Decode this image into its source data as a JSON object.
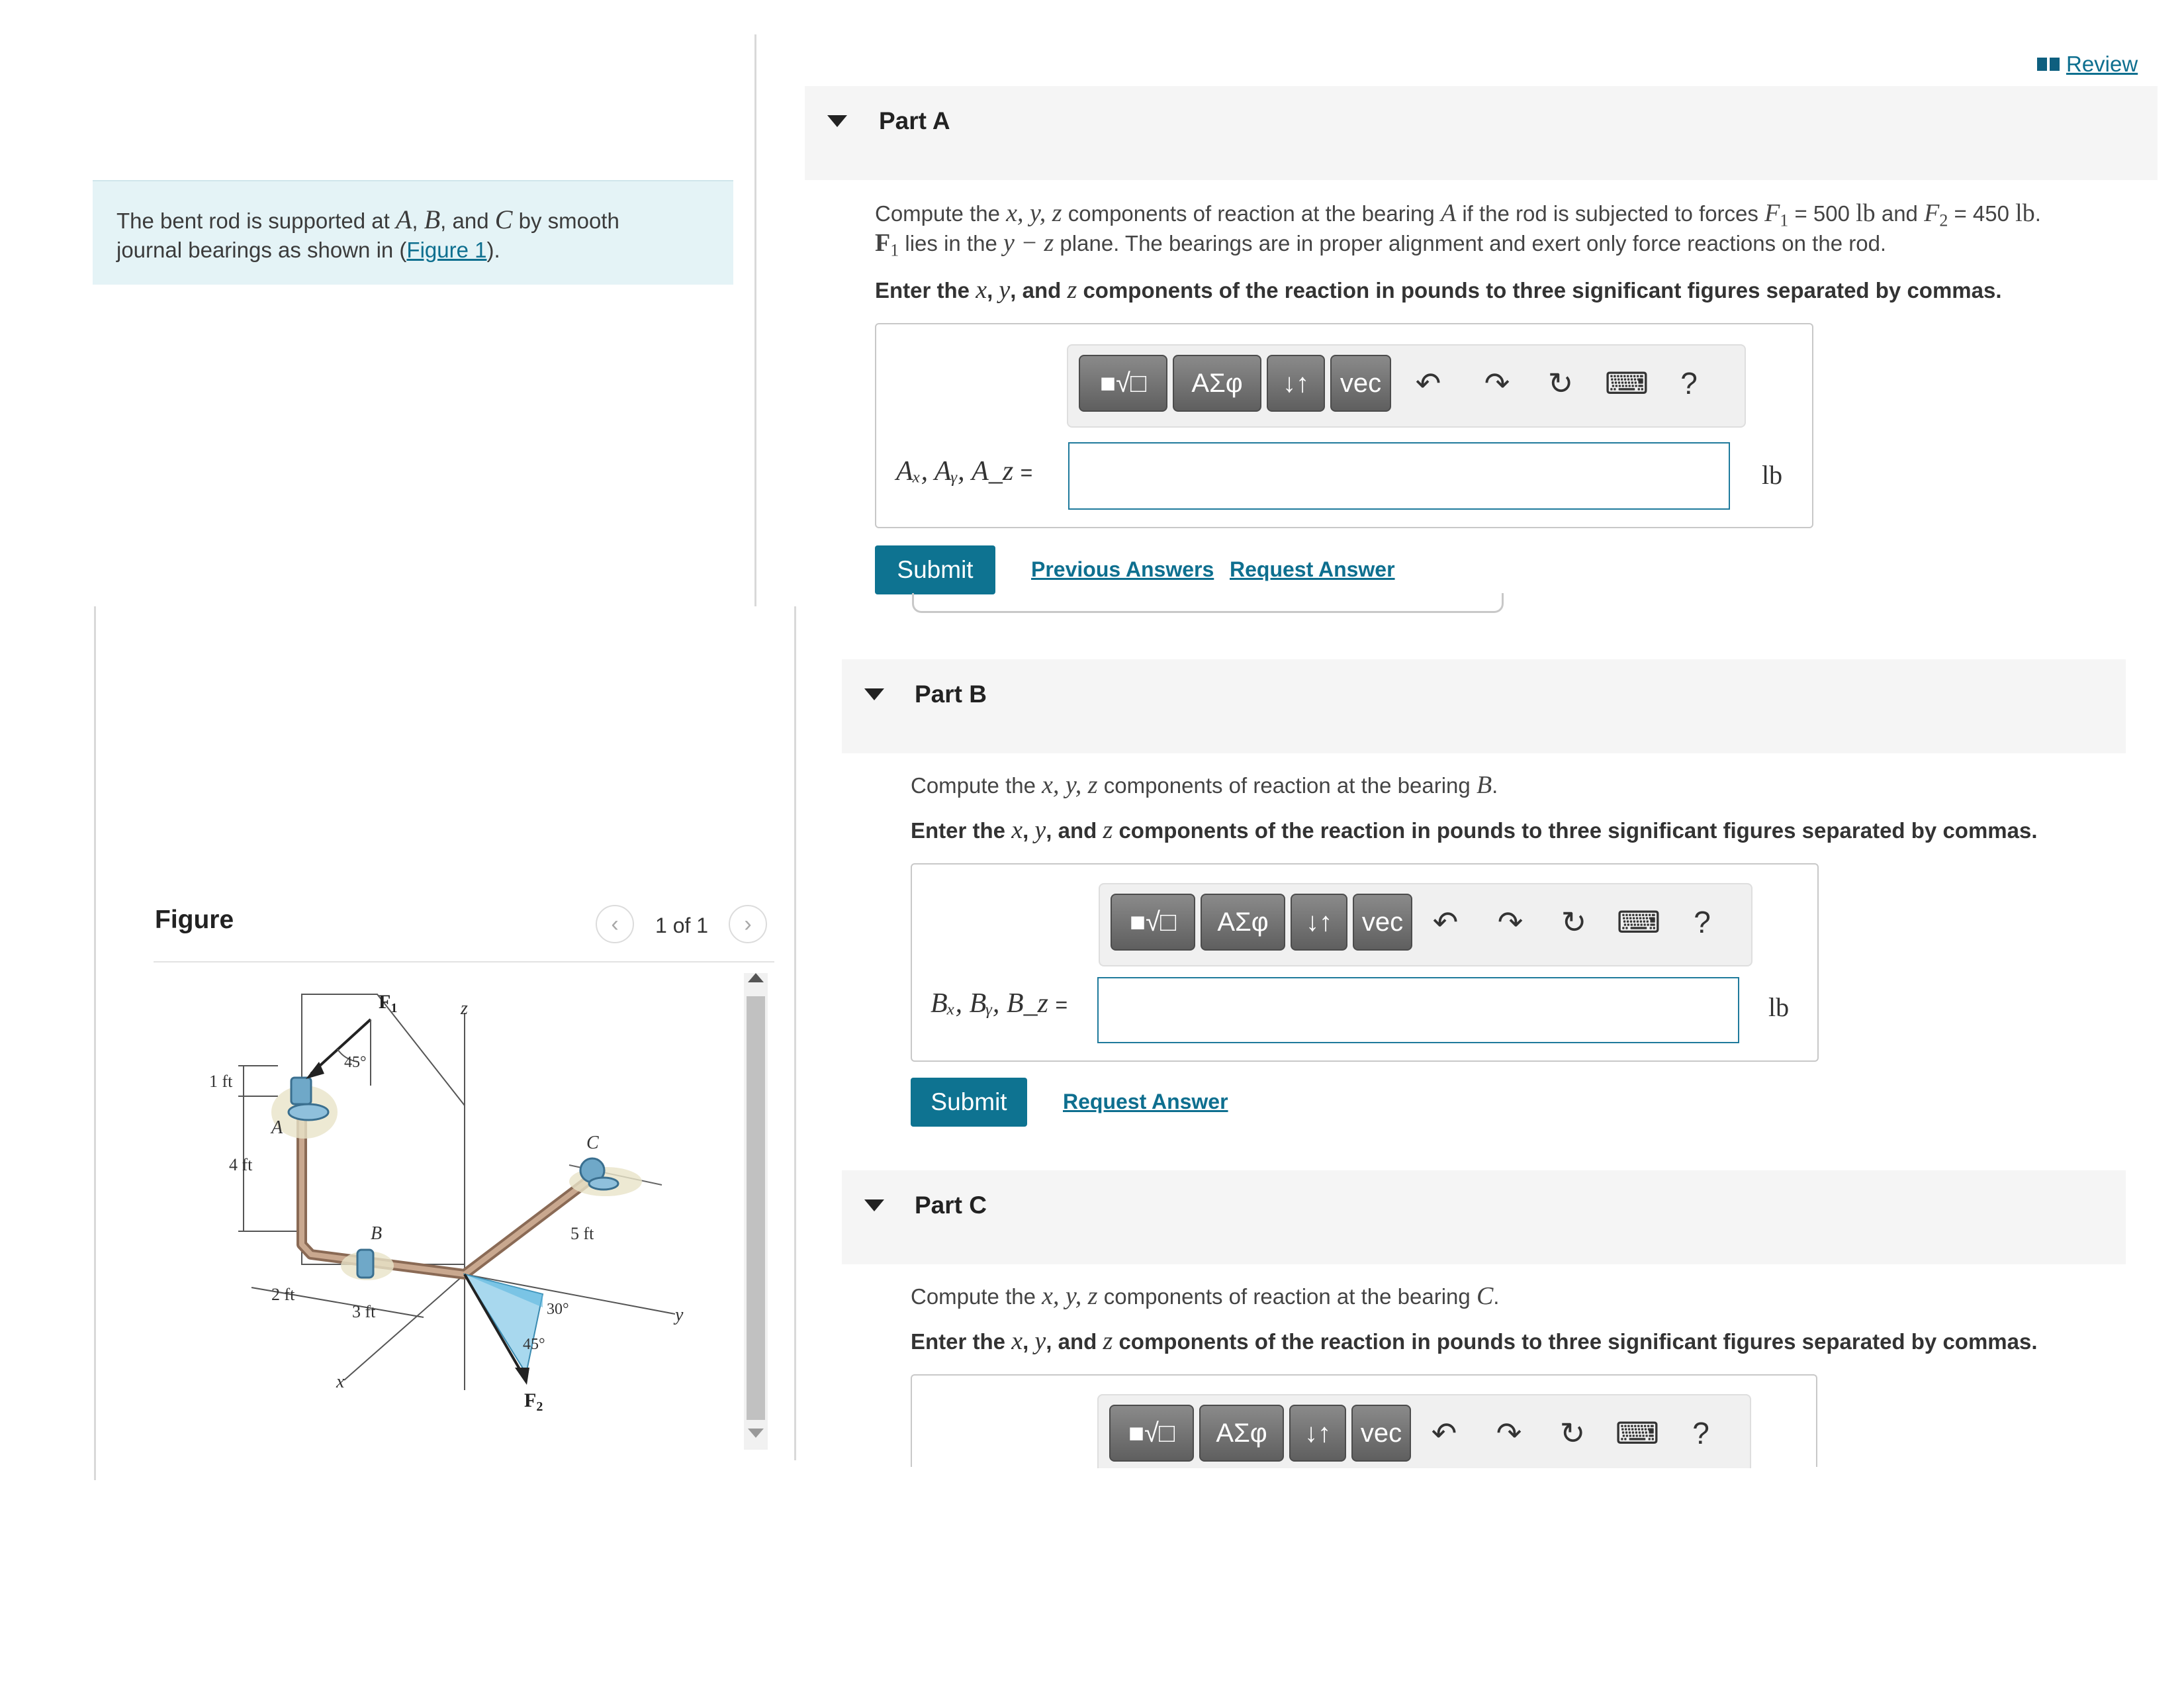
{
  "intro": {
    "text_1": "The bent rod is supported at ",
    "var_a": "A",
    "sep_1": ", ",
    "var_b": "B",
    "sep_2": ", and ",
    "var_c": "C",
    "text_2": " by smooth",
    "text_3": "journal bearings as shown in (",
    "figure_link": "Figure 1",
    "text_4": ")."
  },
  "figure": {
    "title": "Figure",
    "prev": "‹",
    "next": "›",
    "count": "1 of 1",
    "labels": {
      "F1": "F",
      "F1_sub": "1",
      "F2": "F",
      "F2_sub": "2",
      "z": "z",
      "y": "y",
      "x": "x",
      "A": "A",
      "B": "B",
      "C": "C",
      "one_ft": "1 ft",
      "four_ft": "4 ft",
      "two_ft": "2 ft",
      "three_ft": "3 ft",
      "five_ft": "5 ft",
      "deg45_top": "45°",
      "deg30": "30°",
      "deg45_bottom": "45°"
    }
  },
  "review": {
    "label": "Review"
  },
  "toolbar": {
    "templates": "■√□",
    "symbols": "ΑΣφ",
    "arrows": "↓↑",
    "vec": "vec",
    "undo": "↶",
    "redo": "↷",
    "reset": "↻",
    "keyboard": "⌨",
    "help": "?"
  },
  "partA": {
    "title": "Part A",
    "q1_a": "Compute the ",
    "q1_vars": "x, y, z",
    "q1_b": " components of reaction at the bearing ",
    "q1_var": "A",
    "q1_c": " if the rod is subjected to forces ",
    "q1_f1": "F",
    "q1_f1_sub": "1",
    "q1_d": " = 500 ",
    "q1_unit1": "lb",
    "q1_e": " and ",
    "q1_f2": "F",
    "q1_f2_sub": "2",
    "q1_f": " = 450 ",
    "q1_unit2": "lb",
    "q1_g": ".",
    "q2_f1": "F",
    "q2_f1_sub": "1",
    "q2_a": " lies in the ",
    "q2_plane": "y − z",
    "q2_b": " plane. The bearings are in proper alignment and exert only force reactions on the rod.",
    "instr_a": "Enter the ",
    "instr_x": "x",
    "instr_b": ", ",
    "instr_y": "y",
    "instr_c": ", and ",
    "instr_z": "z",
    "instr_d": " components of the reaction in pounds to three significant figures separated by commas.",
    "answer_label": "Aₓ,  Aᵧ,  A_z",
    "answer_value": "",
    "unit": "lb",
    "submit": "Submit",
    "previous_answers": "Previous Answers",
    "request_answer": "Request Answer"
  },
  "partB": {
    "title": "Part B",
    "q1_a": "Compute the ",
    "q1_vars": "x, y, z",
    "q1_b": " components of reaction at the bearing ",
    "q1_var": "B",
    "q1_c": ".",
    "instr_a": "Enter the ",
    "instr_x": "x",
    "instr_b": ", ",
    "instr_y": "y",
    "instr_c": ", and ",
    "instr_z": "z",
    "instr_d": " components of the reaction in pounds to three significant figures separated by commas.",
    "answer_label": "Bₓ,  Bᵧ,  B_z",
    "answer_value": "",
    "unit": "lb",
    "submit": "Submit",
    "request_answer": "Request Answer"
  },
  "partC": {
    "title": "Part C",
    "q1_a": "Compute the ",
    "q1_vars": "x, y, z",
    "q1_b": " components of reaction at the bearing ",
    "q1_var": "C",
    "q1_c": ".",
    "instr_a": "Enter the ",
    "instr_x": "x",
    "instr_b": ", ",
    "instr_y": "y",
    "instr_c": ", and ",
    "instr_z": "z",
    "instr_d": " components of the reaction in pounds to three significant figures separated by commas."
  },
  "colors": {
    "accent": "#0e7391",
    "link": "#0e6f8f",
    "intro_bg": "#e4f3f6",
    "part_header_bg": "#f5f5f5",
    "toolbar_button": "#6f6f6f"
  }
}
